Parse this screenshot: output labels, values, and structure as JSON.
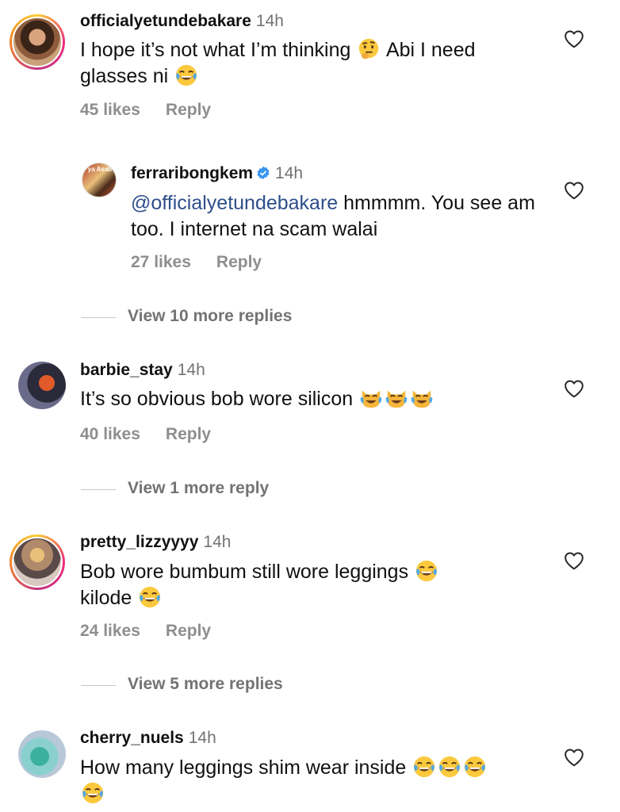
{
  "comments": [
    {
      "username": "officialyetundebakare",
      "time": "14h",
      "text_before": "I hope it’s not what I’m thinking",
      "emoji1": "thinking-face",
      "text_mid": "Abi I need glasses ni",
      "emoji2": "tears-of-joy",
      "likes": "45 likes",
      "reply": "Reply"
    },
    {
      "username": "ferraribongkem",
      "time": "14h",
      "verified": true,
      "mention": "@officialyetundebakare",
      "text": " hmmmm. You see am too. I internet na scam walai",
      "likes": "27 likes",
      "reply": "Reply",
      "avatar_overlay": "ya Asab"
    },
    {
      "username": "barbie_stay",
      "time": "14h",
      "text": "It’s so obvious bob wore silicon",
      "emoji": "crying-cat",
      "likes": "40 likes",
      "reply": "Reply"
    },
    {
      "username": "pretty_lizzyyyy",
      "time": "14h",
      "text_line1": "Bob wore  bumbum still wore leggings",
      "text_line2": "kilode",
      "emoji": "tears-of-joy",
      "likes": "24 likes",
      "reply": "Reply"
    },
    {
      "username": "cherry_nuels",
      "time": "14h",
      "text": "How many leggings shim wear inside",
      "emoji": "tears-of-joy"
    }
  ],
  "view_more": [
    "View 10 more replies",
    "View 1 more reply",
    "View 5 more replies"
  ],
  "icons": {
    "heart": "heart-outline-icon",
    "verified": "verified-badge-icon"
  },
  "colors": {
    "mention": "#2e4f8a",
    "muted": "#8e8e8e",
    "verified": "#3897f0"
  }
}
